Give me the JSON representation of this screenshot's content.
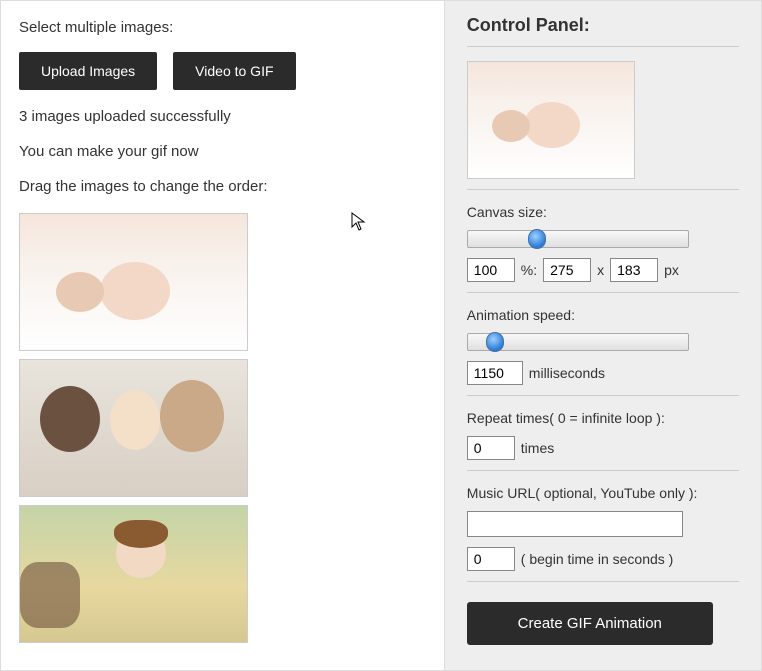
{
  "left": {
    "select_label": "Select multiple images:",
    "upload_button": "Upload Images",
    "video_button": "Video to GIF",
    "upload_status": "3 images uploaded successfully",
    "ready_status": "You can make your gif now",
    "drag_instruction": "Drag the images to change the order:"
  },
  "panel": {
    "title": "Control Panel:",
    "canvas_size_label": "Canvas size:",
    "canvas_percent": "100",
    "percent_suffix": "%:",
    "canvas_width": "275",
    "x_sep": "x",
    "canvas_height": "183",
    "px_suffix": "px",
    "anim_speed_label": "Animation speed:",
    "anim_speed_value": "1150",
    "ms_suffix": "milliseconds",
    "repeat_label": "Repeat times( 0 = infinite loop ):",
    "repeat_value": "0",
    "times_suffix": "times",
    "music_label": "Music URL( optional, YouTube only ):",
    "music_value": "",
    "begin_time_value": "0",
    "begin_time_suffix": "( begin time in seconds )",
    "create_button": "Create GIF Animation"
  }
}
